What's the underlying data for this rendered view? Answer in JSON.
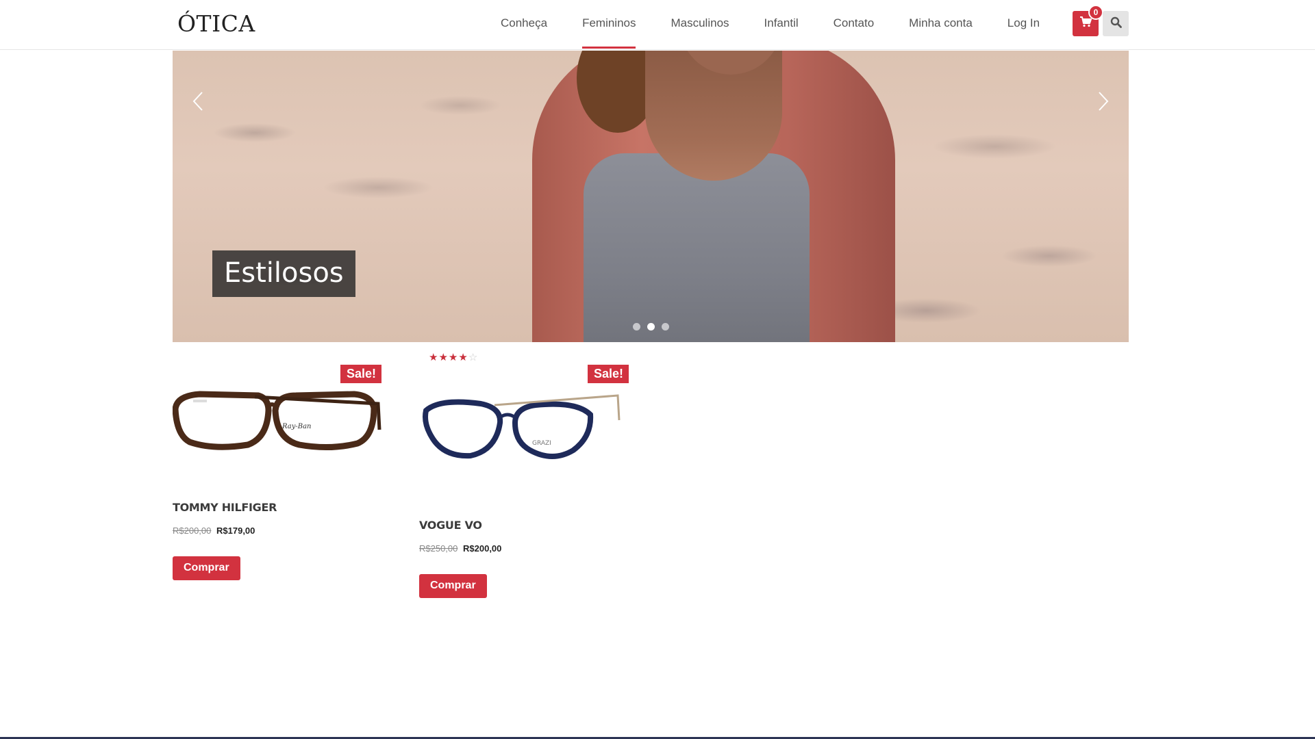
{
  "header": {
    "logo": "ÓTICA",
    "nav": [
      "Conheça",
      "Femininos",
      "Masculinos",
      "Infantil",
      "Contato",
      "Minha conta",
      "Log In"
    ],
    "active_nav": "Femininos",
    "cart_count": "0",
    "cart_icon": "shopping-cart-icon",
    "search_icon": "search-icon",
    "accent_color": "#d2323f"
  },
  "hero": {
    "caption": "Estilosos",
    "slides_total": 3,
    "active_slide": 2
  },
  "products": [
    {
      "name": "TOMMY HILFIGER",
      "sale_label": "Sale!",
      "old_price": "R$200,00",
      "new_price": "R$179,00",
      "button": "Comprar"
    },
    {
      "name": "VOGUE VO",
      "sale_label": "Sale!",
      "rating": 4,
      "rating_max": 5,
      "old_price": "R$250,00",
      "new_price": "R$200,00",
      "button": "Comprar"
    }
  ]
}
